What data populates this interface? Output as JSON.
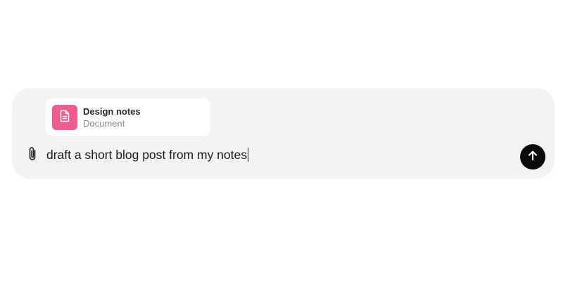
{
  "composer": {
    "attachment": {
      "title": "Design notes",
      "subtitle": "Document",
      "icon": "document-icon",
      "tile_color": "#ee5e8c"
    },
    "attach_icon": "paperclip-icon",
    "input_value": "draft a short blog post from my notes",
    "send_icon": "arrow-up-icon",
    "send_button_color": "#0b0b0b"
  }
}
